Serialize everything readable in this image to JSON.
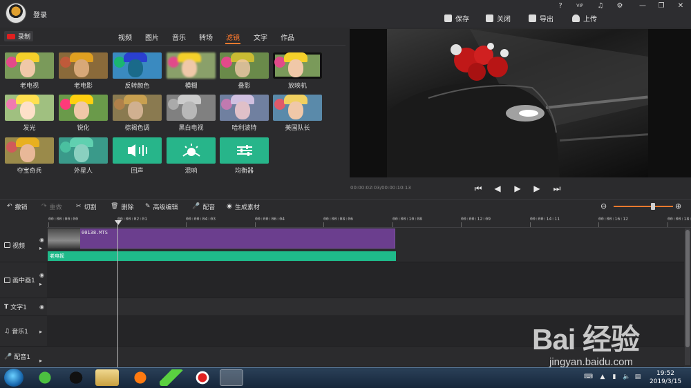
{
  "titlebar": {
    "login": "登录",
    "help": "?",
    "vip": "VIP",
    "buttons": [
      {
        "label": "保存",
        "icon": "save-icon"
      },
      {
        "label": "关闭",
        "icon": "close-icon"
      },
      {
        "label": "导出",
        "icon": "export-icon"
      },
      {
        "label": "上传",
        "icon": "upload-icon"
      }
    ]
  },
  "media": {
    "record": "录制",
    "tabs": [
      "视频",
      "图片",
      "音乐",
      "转场",
      "滤镜",
      "文字",
      "作品"
    ],
    "active_tab": "滤镜",
    "filters": [
      "老电视",
      "老电影",
      "反转颜色",
      "模糊",
      "叠影",
      "放映机",
      "发光",
      "锐化",
      "棕褐色调",
      "黑白电视",
      "哈利波特",
      "美国队长",
      "夺宝奇兵",
      "外星人",
      "回声",
      "混响",
      "均衡器"
    ]
  },
  "preview": {
    "timecode": "00:00:02:03/00:00:10:13"
  },
  "toolbar": {
    "undo": "撤销",
    "redo": "重做",
    "cut": "切割",
    "delete": "删除",
    "advanced": "高级编辑",
    "dub": "配音",
    "generate": "生成素材",
    "zoom_level": 0.66
  },
  "ruler": {
    "labels": [
      "00:00:00:00",
      "00:00:02:01",
      "00:00:04:03",
      "00:00:06:04",
      "00:00:08:06",
      "00:00:10:08",
      "00:00:12:09",
      "00:00:14:11",
      "00:00:16:12",
      "00:00:18:"
    ]
  },
  "tracks": {
    "video": "视频",
    "pip": "画中画1",
    "text": "文字1",
    "music": "音乐1",
    "voice": "配音1",
    "clip_name": "00138.MTS",
    "filter_clip": "老电视"
  },
  "watermark": {
    "logo": "Bai 经验",
    "url": "jingyan.baidu.com"
  },
  "taskbar": {
    "time": "19:52",
    "date": "2019/3/15"
  },
  "colors": {
    "accent": "#ff7a2e",
    "clip": "#6b3e8e",
    "filter": "#1fba8a"
  }
}
